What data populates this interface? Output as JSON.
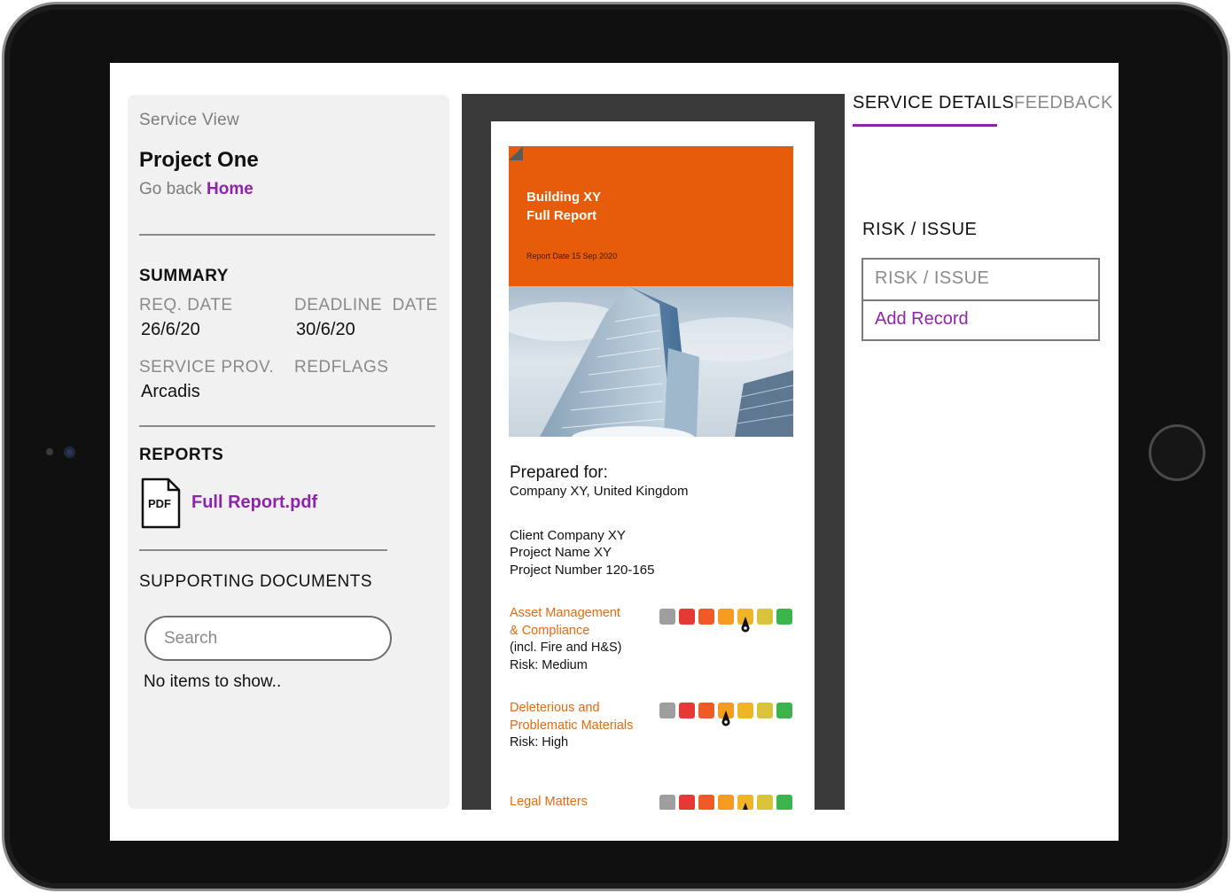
{
  "left": {
    "view_label": "Service View",
    "project_title": "Project One",
    "go_back_text": "Go back",
    "home_link": "Home",
    "summary": {
      "heading": "SUMMARY",
      "req_date_label": "REQ. DATE",
      "req_date_value": "26/6/20",
      "deadline_label": "DEADLINE  DATE",
      "deadline_value": "30/6/20",
      "service_prov_label": "SERVICE PROV.",
      "service_prov_value": "Arcadis",
      "redflags_label": "REDFLAGS"
    },
    "reports": {
      "heading": "REPORTS",
      "file_icon_text": "PDF",
      "file_name": "Full Report.pdf"
    },
    "supporting": {
      "heading": "SUPPORTING DOCUMENTS",
      "search_placeholder": "Search",
      "empty_text": "No items to show.."
    }
  },
  "document": {
    "cover_title_line1": "Building XY",
    "cover_title_line2": "Full Report",
    "cover_date": "Report Date 15 Sep 2020",
    "prepared_for": "Prepared for:",
    "prepared_for_value": "Company XY, United Kingdom",
    "client": "Client Company XY",
    "project_name": "Project Name XY",
    "project_number": "Project Number 120-165",
    "risk_scale_colors": [
      "#9e9e9e",
      "#e53935",
      "#f05a28",
      "#f59a23",
      "#f0b429",
      "#d9c23c",
      "#3cb44b"
    ],
    "risks": [
      {
        "name_line1": "Asset Management",
        "name_line2": "& Compliance",
        "detail": "(incl. Fire and H&S)",
        "risk": "Risk: Medium",
        "level_index": 4
      },
      {
        "name_line1": "Deleterious and",
        "name_line2": "Problematic Materials",
        "risk": "Risk: High",
        "level_index": 3
      },
      {
        "name_line1": "Legal Matters",
        "level_index": 4
      }
    ]
  },
  "right": {
    "tabs": [
      {
        "label": "SERVICE DETAILS",
        "active": true
      },
      {
        "label": "FEEDBACK",
        "active": false
      }
    ],
    "risk_heading": "RISK / ISSUE",
    "risk_column_header": "RISK / ISSUE",
    "add_record": "Add Record"
  },
  "colors": {
    "accent": "#8e24aa",
    "cover_orange": "#e65c0a",
    "risk_orange": "#e66a0f"
  }
}
